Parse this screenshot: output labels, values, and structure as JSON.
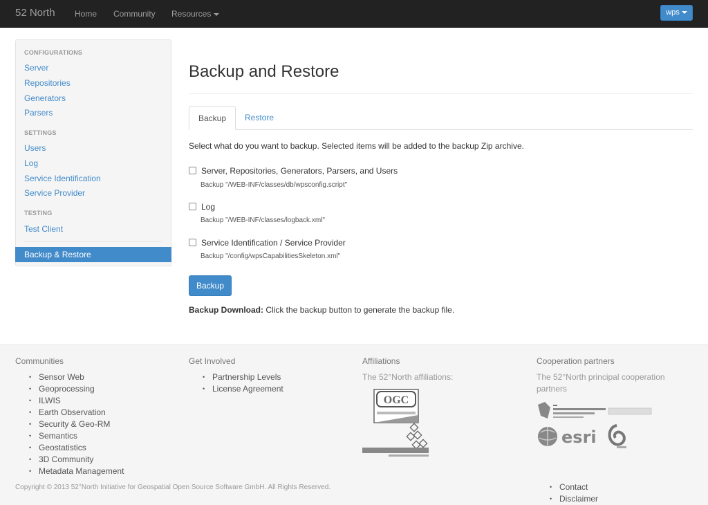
{
  "navbar": {
    "brand": "52 North",
    "items": [
      "Home",
      "Community",
      "Resources"
    ],
    "user_button": "wps"
  },
  "sidebar": {
    "headers": [
      "CONFIGURATIONS",
      "SETTINGS",
      "TESTING"
    ],
    "configurations": [
      "Server",
      "Repositories",
      "Generators",
      "Parsers"
    ],
    "settings": [
      "Users",
      "Log",
      "Service Identification",
      "Service Provider"
    ],
    "testing": [
      "Test Client"
    ],
    "active": "Backup & Restore"
  },
  "main": {
    "title": "Backup and Restore",
    "tabs": [
      "Backup",
      "Restore"
    ],
    "intro": "Select what do you want to backup. Selected items will be added to the backup Zip archive.",
    "options": [
      {
        "label": "Server, Repositories, Generators, Parsers, and Users",
        "note": "Backup \"/WEB-INF/classes/db/wpsconfig.script\""
      },
      {
        "label": "Log",
        "note": "Backup \"/WEB-INF/classes/logback.xml\""
      },
      {
        "label": "Service Identification / Service Provider",
        "note": "Backup \"/config/wpsCapabilitiesSkeleton.xml\""
      }
    ],
    "backup_button": "Backup",
    "download_label": "Backup Download:",
    "download_text": " Click the backup button to generate the backup file."
  },
  "footer": {
    "communities": {
      "title": "Communities",
      "items": [
        "Sensor Web",
        "Geoprocessing",
        "ILWIS",
        "Earth Observation",
        "Security & Geo-RM",
        "Semantics",
        "Geostatistics",
        "3D Community",
        "Metadata Management"
      ]
    },
    "get_involved": {
      "title": "Get Involved",
      "items": [
        "Partnership Levels",
        "License Agreement"
      ]
    },
    "affiliations": {
      "title": "Affiliations",
      "text": "The 52°North affiliations:"
    },
    "partners": {
      "title": "Cooperation partners",
      "text": "The 52°North principal cooperation partners"
    },
    "copyright": "Copyright © 2013 52°North Initiative for Geospatial Open Source Software GmbH. All Rights Reserved.",
    "links": [
      "Contact",
      "Disclaimer"
    ]
  }
}
